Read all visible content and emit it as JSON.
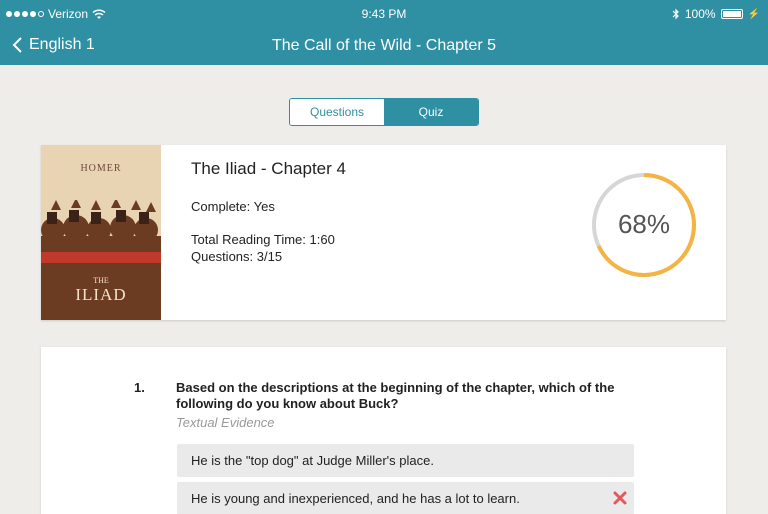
{
  "status": {
    "carrier": "Verizon",
    "time": "9:43 PM",
    "battery": "100%"
  },
  "nav": {
    "back_label": "English 1",
    "title": "The Call of the Wild - Chapter 5"
  },
  "segment": {
    "questions_label": "Questions",
    "quiz_label": "Quiz",
    "selected": "Quiz"
  },
  "book": {
    "cover_author": "HOMER",
    "cover_the": "THE",
    "cover_title": "ILIAD",
    "title": "The Iliad - Chapter 4",
    "complete": "Complete: Yes",
    "reading_time": "Total Reading Time: 1:60",
    "questions": "Questions: 3/15",
    "progress_label": "68%",
    "progress_value": 0.68
  },
  "quiz": {
    "number": "1.",
    "question": "Based on the descriptions at the beginning of the chapter, which of the following do you know about Buck?",
    "tag": "Textual Evidence",
    "answers": [
      {
        "text": "He is the \"top dog\" at Judge Miller's place.",
        "status": "none"
      },
      {
        "text": "He is young and inexperienced, and he has a lot to learn.",
        "status": "incorrect"
      }
    ]
  },
  "colors": {
    "accent": "#2f8fa3",
    "progress": "#f5b342",
    "ring_track": "#d6d6d6",
    "incorrect": "#e05a5a",
    "background": "#efedea"
  }
}
